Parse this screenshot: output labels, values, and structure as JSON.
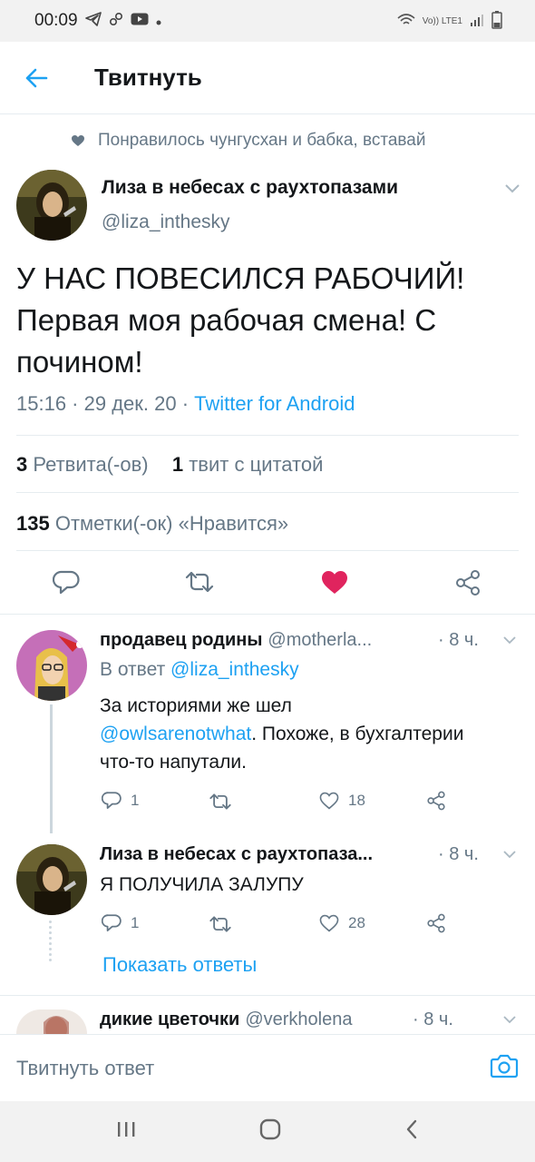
{
  "status_bar": {
    "time": "00:09",
    "network": "Vo)) LTE1",
    "icons": [
      "telegram-icon",
      "link-icon",
      "youtube-icon",
      "dot-icon",
      "wifi-icon",
      "signal-icon",
      "battery-icon"
    ]
  },
  "header": {
    "title": "Твитнуть"
  },
  "liked_by": "Понравилось чунгусхан и бабка, вставай",
  "tweet": {
    "name": "Лиза в небесах с раухтопазами",
    "handle": "@liza_inthesky",
    "text": "У НАС ПОВЕСИЛСЯ РАБОЧИЙ! Первая моя рабочая смена! С почином!",
    "time_date": "15:16 · 29 дек. 20 · ",
    "source": "Twitter for Android",
    "retweets_count": "3",
    "retweets_label": "Ретвита(-ов)",
    "quotes_count": "1",
    "quotes_label": "твит с цитатой",
    "likes_count": "135",
    "likes_label": "Отметки(-ок) «Нравится»",
    "liked_by_me": true
  },
  "replies": [
    {
      "name": "продавец родины",
      "handle": "@motherla...",
      "time": "· 8 ч.",
      "reply_to_prefix": "В ответ ",
      "reply_to_handle": "@liza_inthesky",
      "text_line1": "За историями же шел",
      "mention": "@owlsarenotwhat",
      "text_rest": ". Похоже, в бухгалтерии что-то напутали.",
      "reply_count": "1",
      "like_count": "18"
    },
    {
      "name": "Лиза в небесах с раухтопаза...",
      "time": "· 8 ч.",
      "text": "Я ПОЛУЧИЛА ЗАЛУПУ",
      "reply_count": "1",
      "like_count": "28"
    },
    {
      "name": "дикие цветочки",
      "handle": "@verkholena",
      "time": "· 8 ч."
    }
  ],
  "show_replies": "Показать ответы",
  "reply_bar": {
    "placeholder": "Твитнуть ответ"
  },
  "colors": {
    "accent": "#1da1f2",
    "like": "#e0245e",
    "secondary_text": "#657786"
  }
}
